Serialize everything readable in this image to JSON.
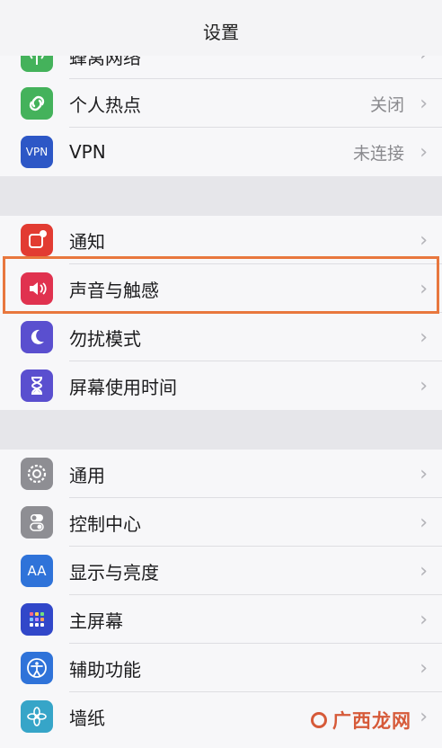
{
  "header": {
    "title": "设置"
  },
  "group1": [
    {
      "label": "蜂窝网络",
      "value": "",
      "icon": "cellular-antenna-icon",
      "color": "#44b25b"
    },
    {
      "label": "个人热点",
      "value": "关闭",
      "icon": "hotspot-link-icon",
      "color": "#44b25b"
    },
    {
      "label": "VPN",
      "value": "未连接",
      "icon": "vpn-icon",
      "icon_text": "VPN",
      "color": "#2d57c6"
    }
  ],
  "group2": [
    {
      "label": "通知",
      "value": "",
      "icon": "notifications-icon",
      "color": "#e23b32"
    },
    {
      "label": "声音与触感",
      "value": "",
      "icon": "speaker-icon",
      "color": "#e0324f"
    },
    {
      "label": "勿扰模式",
      "value": "",
      "icon": "moon-icon",
      "color": "#5a4fcf"
    },
    {
      "label": "屏幕使用时间",
      "value": "",
      "icon": "hourglass-icon",
      "color": "#5a4fcf"
    }
  ],
  "group3": [
    {
      "label": "通用",
      "value": "",
      "icon": "gear-icon",
      "color": "#8e8e93"
    },
    {
      "label": "控制中心",
      "value": "",
      "icon": "toggles-icon",
      "color": "#8e8e93"
    },
    {
      "label": "显示与亮度",
      "value": "",
      "icon": "text-size-icon",
      "icon_text": "AA",
      "color": "#2f73d9"
    },
    {
      "label": "主屏幕",
      "value": "",
      "icon": "home-grid-icon",
      "color": "#3147c9"
    },
    {
      "label": "辅助功能",
      "value": "",
      "icon": "accessibility-icon",
      "color": "#2f73d9"
    },
    {
      "label": "墙纸",
      "value": "",
      "icon": "flower-icon",
      "color": "#36a5c8"
    }
  ],
  "chevron": "›",
  "watermark": "广西龙网"
}
